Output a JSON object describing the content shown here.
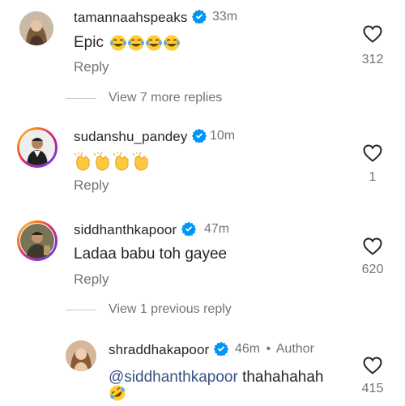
{
  "comments": [
    {
      "username": "tamannaahspeaks",
      "time": "33m",
      "text": "Epic",
      "emoji": "laughing-tears x4",
      "reply_label": "Reply",
      "likes": "312"
    },
    {
      "username": "sudanshu_pandey",
      "time": "10m",
      "emoji": "clapping-hands x4",
      "reply_label": "Reply",
      "likes": "1"
    },
    {
      "username": "siddhanthkapoor",
      "time": "47m",
      "text": "Ladaa babu toh gayee",
      "reply_label": "Reply",
      "likes": "620"
    }
  ],
  "view_more_replies": "View 7 more replies",
  "view_previous_reply": "View 1 previous reply",
  "reply": {
    "username": "shraddhakapoor",
    "time": "46m",
    "separator": "•",
    "author_label": "Author",
    "mention": "@siddhanthkapoor",
    "text": " thahahahah",
    "emoji": "rolling-laughing",
    "likes": "415"
  },
  "colors": {
    "verified": "#0095f6",
    "mention": "#385185",
    "muted": "#737373"
  }
}
